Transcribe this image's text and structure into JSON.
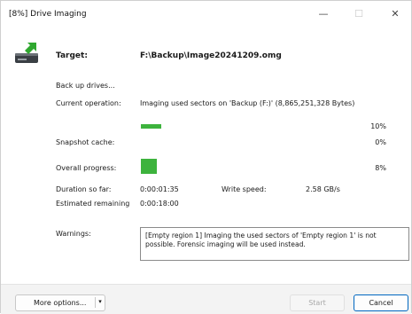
{
  "window": {
    "title": "[8%] Drive Imaging",
    "minimize_glyph": "—",
    "maximize_glyph": "☐",
    "close_glyph": "✕"
  },
  "icon": {
    "name": "drive-image-icon",
    "accent": "#2fa82f"
  },
  "target": {
    "label": "Target:",
    "value": "F:\\Backup\\Image20241209.omg"
  },
  "status_line": "Back up drives...",
  "current_operation": {
    "label": "Current operation:",
    "value": "Imaging used sectors on 'Backup (F:)' (8,865,251,328 Bytes)",
    "progress_text": "10%",
    "progress": 0.1
  },
  "snapshot_cache": {
    "label": "Snapshot cache:",
    "progress_text": "0%",
    "progress": 0.0
  },
  "overall_progress": {
    "label": "Overall progress:",
    "progress_text": "8%",
    "progress": 0.08
  },
  "duration": {
    "label": "Duration so far:",
    "value": "0:00:01:35"
  },
  "write_speed": {
    "label": "Write speed:",
    "value": "2.58 GB/s"
  },
  "estimated_remaining": {
    "label": "Estimated remaining",
    "value": "0:00:18:00"
  },
  "warnings": {
    "label": "Warnings:",
    "text": "[Empty region 1] Imaging the used sectors of 'Empty region 1' is not possible. Forensic imaging will be used instead."
  },
  "footer": {
    "more_options_label": "More options...",
    "dropdown_glyph": "▾",
    "start_label": "Start",
    "cancel_label": "Cancel"
  },
  "colors": {
    "progress_fill": "#3db33d",
    "cancel_border": "#0067c0"
  }
}
